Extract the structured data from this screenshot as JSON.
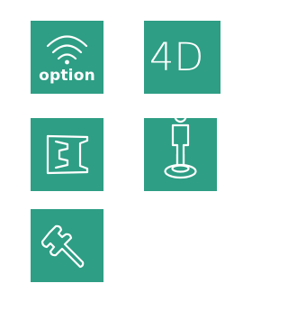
{
  "theme": {
    "tile_color": "#2e9e84",
    "icon_color": "#ffffff",
    "background": "#ffffff"
  },
  "tiles": [
    {
      "name": "option",
      "icon": "wireless-signal-icon",
      "label": "option"
    },
    {
      "name": "4d",
      "icon": "none",
      "label": "4D"
    },
    {
      "name": "seat-system",
      "icon": "seat-profile-icon",
      "label": ""
    },
    {
      "name": "user-position",
      "icon": "person-on-target-icon",
      "label": ""
    },
    {
      "name": "service",
      "icon": "wrench-icon",
      "label": ""
    }
  ]
}
